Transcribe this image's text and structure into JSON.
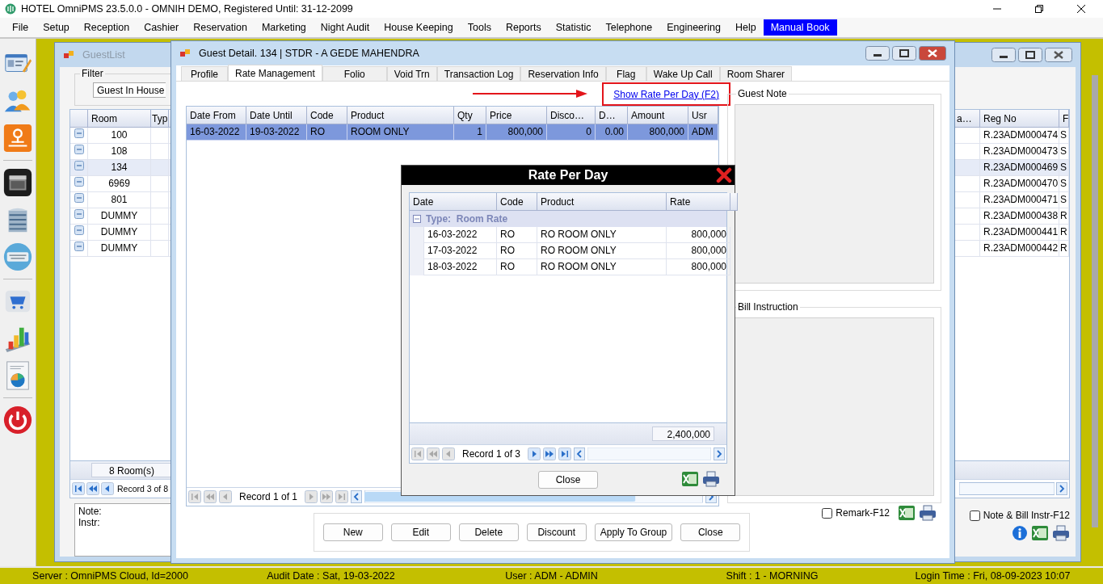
{
  "window": {
    "title": "HOTEL OmniPMS 23.5.0.0 - OMNIH DEMO, Registered Until: 31-12-2099"
  },
  "menu": [
    {
      "label": "File",
      "selected": false
    },
    {
      "label": "Setup",
      "selected": false
    },
    {
      "label": "Reception",
      "selected": false
    },
    {
      "label": "Cashier",
      "selected": false
    },
    {
      "label": "Reservation",
      "selected": false
    },
    {
      "label": "Marketing",
      "selected": false
    },
    {
      "label": "Night Audit",
      "selected": false
    },
    {
      "label": "House Keeping",
      "selected": false
    },
    {
      "label": "Tools",
      "selected": false
    },
    {
      "label": "Reports",
      "selected": false
    },
    {
      "label": "Statistic",
      "selected": false
    },
    {
      "label": "Telephone",
      "selected": false
    },
    {
      "label": "Engineering",
      "selected": false
    },
    {
      "label": "Help",
      "selected": false
    },
    {
      "label": "Manual Book",
      "selected": true
    }
  ],
  "guest_list": {
    "title": "GuestList",
    "filter_label": "Filter",
    "filter_value": "Guest In House",
    "columns": [
      "Room",
      "Typ",
      "a…",
      "Reg No",
      "F"
    ],
    "rows": [
      {
        "room": "100",
        "reg_no": "R.23ADM000474",
        "column_6": "S",
        "selected": false
      },
      {
        "room": "108",
        "reg_no": "R.23ADM000473",
        "column_6": "S",
        "selected": false
      },
      {
        "room": "134",
        "reg_no": "R.23ADM000469",
        "column_6": "S",
        "selected": true
      },
      {
        "room": "6969",
        "reg_no": "R.23ADM000470",
        "column_6": "S",
        "selected": false
      },
      {
        "room": "801",
        "reg_no": "R.23ADM000471",
        "column_6": "S",
        "selected": false
      },
      {
        "room": "DUMMY",
        "reg_no": "R.23ADM000438",
        "column_6": "R",
        "selected": false
      },
      {
        "room": "DUMMY",
        "reg_no": "R.23ADM000441",
        "column_6": "R",
        "selected": false
      },
      {
        "room": "DUMMY",
        "reg_no": "R.23ADM000442",
        "column_6": "R",
        "selected": false
      }
    ],
    "footer": "8 Room(s)",
    "navigator": {
      "record": "Record 3 of 8",
      "prev_enabled": true
    },
    "note_label": "Note:",
    "instr_label": "Instr:",
    "note_checkbox": {
      "label": "Note & Bill Instr-F12",
      "checked": false
    }
  },
  "guest_detail": {
    "title": "Guest Detail. 134 | STDR - A GEDE MAHENDRA",
    "tabs": [
      {
        "label": "Profile",
        "selected": false
      },
      {
        "label": "Rate Management",
        "selected": true
      },
      {
        "label": "Folio",
        "selected": false
      },
      {
        "label": "Void Trn",
        "selected": false
      },
      {
        "label": "Transaction Log",
        "selected": false
      },
      {
        "label": "Reservation Info",
        "selected": false
      },
      {
        "label": "Flag",
        "selected": false
      },
      {
        "label": "Wake Up Call",
        "selected": false
      },
      {
        "label": "Room Sharer",
        "selected": false
      }
    ],
    "link": "Show Rate Per Day (F2)",
    "columns": [
      "Date From",
      "Date Until",
      "Code",
      "Product",
      "Qty",
      "Price",
      "Disco…",
      "D…",
      "Amount",
      "Usr"
    ],
    "rows": [
      {
        "cells": [
          "16-03-2022",
          "19-03-2022",
          "RO",
          "ROOM ONLY",
          "1",
          "800,000",
          "0",
          "0.00",
          "800,000",
          "ADM"
        ],
        "selected": true
      }
    ],
    "navigator": {
      "record": "Record 1 of 1",
      "prev_enabled": false,
      "next_enabled": false
    },
    "guest_note_label": "Guest Note",
    "bill_instruction_label": "Bill Instruction",
    "remark_checkbox": {
      "label": "Remark-F12",
      "checked": false
    },
    "buttons": [
      "New",
      "Edit",
      "Delete",
      "Discount",
      "Apply To Group",
      "Close"
    ]
  },
  "rate_dialog": {
    "title": "Rate Per Day",
    "columns": [
      "Date",
      "Code",
      "Product",
      "Rate"
    ],
    "group": "Type:  Room Rate",
    "rows": [
      [
        "16-03-2022",
        "RO",
        "RO ROOM ONLY",
        "800,000"
      ],
      [
        "17-03-2022",
        "RO",
        "RO ROOM ONLY",
        "800,000"
      ],
      [
        "18-03-2022",
        "RO",
        "RO ROOM ONLY",
        "800,000"
      ]
    ],
    "total": "2,400,000",
    "navigator": {
      "record": "Record 1 of 3",
      "prev_enabled": false,
      "next_enabled": true
    },
    "close": "Close"
  },
  "status_bar": [
    "Server : OmniPMS Cloud, Id=2000",
    "Audit Date : Sat, 19-03-2022",
    "User : ADM - ADMIN",
    "Shift : 1 - MORNING",
    "Login Time : Fri, 08-09-2023 10:07"
  ]
}
